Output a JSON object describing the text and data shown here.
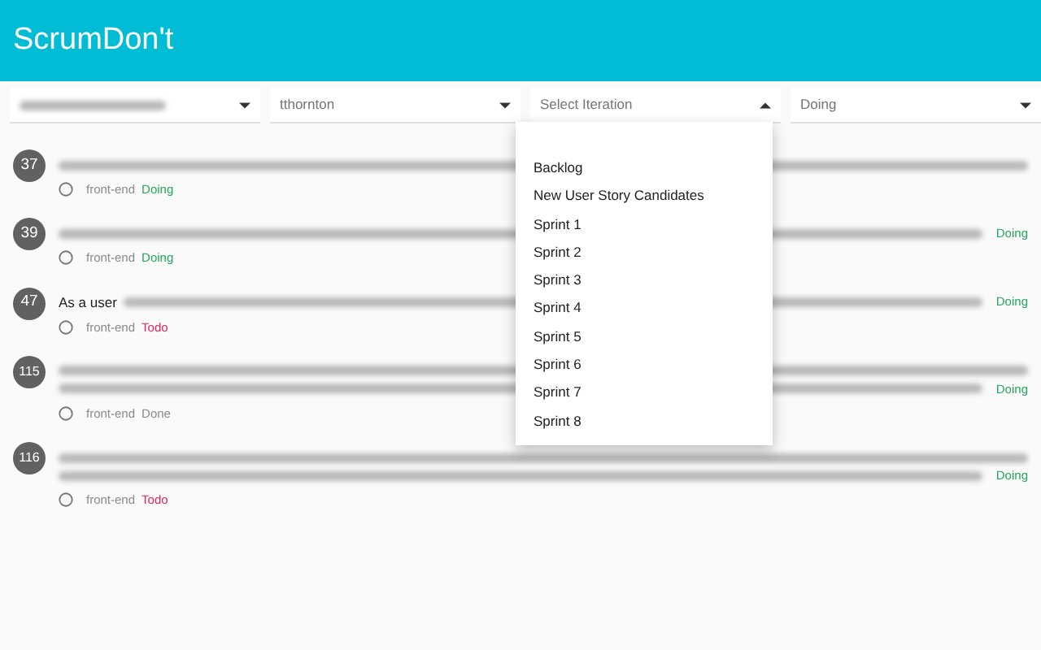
{
  "app_bar": {
    "title": "ScrumDon't"
  },
  "filters": [
    {
      "kind": "blurred",
      "expanded": false
    },
    {
      "kind": "value",
      "value": "tthornton",
      "expanded": false
    },
    {
      "kind": "placeholder",
      "placeholder": "Select Iteration",
      "expanded": true,
      "options": [
        "Backlog",
        "New User Story Candidates",
        "Sprint 1",
        "Sprint 2",
        "Sprint 3",
        "Sprint 4",
        "Sprint 5",
        "Sprint 6",
        "Sprint 7",
        "Sprint 8"
      ]
    },
    {
      "kind": "value",
      "value": "Doing",
      "expanded": false
    }
  ],
  "stories": [
    {
      "number": "37",
      "lines": [
        [
          {
            "kind": "blurred"
          }
        ]
      ],
      "checked": false,
      "tag": "front-end",
      "status": {
        "text": "Doing",
        "color": "#26a65b"
      }
    },
    {
      "number": "39",
      "lines": [
        [
          {
            "kind": "blurred"
          },
          {
            "kind": "status",
            "text": "Doing",
            "color": "#26a65b"
          }
        ]
      ],
      "checked": false,
      "tag": "front-end",
      "status": {
        "text": "Doing",
        "color": "#26a65b"
      }
    },
    {
      "number": "47",
      "lines": [
        [
          {
            "kind": "text",
            "text": "As a user"
          },
          {
            "kind": "blurred"
          },
          {
            "kind": "status",
            "text": "Doing",
            "color": "#26a65b"
          }
        ]
      ],
      "checked": false,
      "tag": "front-end",
      "status": {
        "text": "Todo",
        "color": "#e0245e"
      }
    },
    {
      "number": "115",
      "lines": [
        [
          {
            "kind": "blurred"
          }
        ],
        [
          {
            "kind": "blurred"
          },
          {
            "kind": "status",
            "text": "Doing",
            "color": "#26a65b"
          }
        ]
      ],
      "checked": false,
      "tag": "front-end",
      "status": {
        "text": "Done",
        "color": "#8a8a8a"
      }
    },
    {
      "number": "116",
      "lines": [
        [
          {
            "kind": "blurred"
          }
        ],
        [
          {
            "kind": "blurred"
          },
          {
            "kind": "status",
            "text": "Doing",
            "color": "#26a65b"
          }
        ]
      ],
      "checked": false,
      "tag": "front-end",
      "status": {
        "text": "Todo",
        "color": "#e0245e"
      }
    }
  ]
}
